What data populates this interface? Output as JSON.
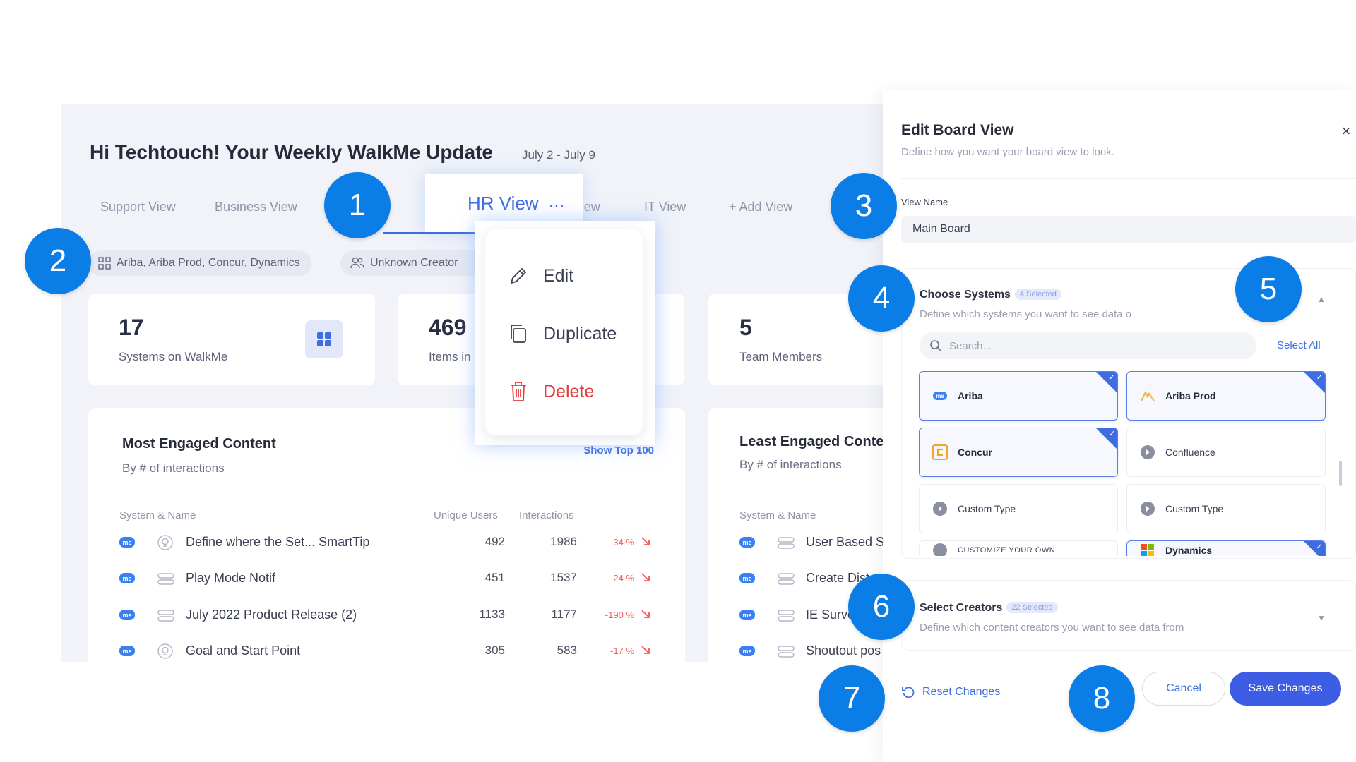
{
  "dashboard": {
    "greeting": "Hi Techtouch! Your Weekly WalkMe Update",
    "date_range": "July 2 - July 9",
    "tabs": {
      "support": "Support View",
      "business": "Business View",
      "hr": "HR View",
      "hr_more": "...",
      "exec": "Exec View",
      "it": "IT View",
      "add": "+ Add View"
    },
    "filters": {
      "systems": "Ariba, Ariba Prod, Concur, Dynamics",
      "creators": "Unknown Creator"
    },
    "cards": [
      {
        "value": "17",
        "label": "Systems on WalkMe"
      },
      {
        "value": "469",
        "label": "Items in"
      },
      {
        "value": "5",
        "label": "Team Members"
      }
    ],
    "most_engaged": {
      "title": "Most Engaged Content",
      "subtitle": "By # of interactions",
      "link": "Show Top 100",
      "columns": {
        "name": "System & Name",
        "users": "Unique Users",
        "interactions": "Interactions"
      },
      "rows": [
        {
          "badge": "me",
          "name": "Define where the Set... SmartTip",
          "icon": "smarttip-icon",
          "users": "492",
          "interactions": "1986",
          "change": "-34 %"
        },
        {
          "badge": "me",
          "name": "Play Mode Notif",
          "icon": "launcher-icon",
          "users": "451",
          "interactions": "1537",
          "change": "-24 %"
        },
        {
          "badge": "me",
          "name": "July 2022 Product Release (2)",
          "icon": "launcher-icon",
          "users": "1133",
          "interactions": "1177",
          "change": "-190 %"
        },
        {
          "badge": "me",
          "name": "Goal and Start Point",
          "icon": "smarttip-icon",
          "users": "305",
          "interactions": "583",
          "change": "-17 %"
        }
      ]
    },
    "least_engaged": {
      "title": "Least Engaged Conte",
      "subtitle": "By # of interactions",
      "columns": {
        "name": "System & Name"
      },
      "rows": [
        {
          "badge": "me",
          "name": "User Based S"
        },
        {
          "badge": "me",
          "name": "Create Dist"
        },
        {
          "badge": "me",
          "name": "IE Surve"
        },
        {
          "badge": "me",
          "name": "Shoutout pos"
        }
      ]
    }
  },
  "context_menu": {
    "edit": "Edit",
    "duplicate": "Duplicate",
    "delete": "Delete"
  },
  "drawer": {
    "title": "Edit Board View",
    "subtitle": "Define how you want your board view to look.",
    "close": "×",
    "view_name_label": "View Name",
    "view_name_value": "Main Board",
    "systems": {
      "title": "Choose Systems",
      "badge": "4 Selected",
      "subtitle": "Define which systems you want to see data o",
      "chevron": "▲",
      "search_placeholder": "Search...",
      "select_all": "Select All",
      "items": [
        {
          "label": "Ariba",
          "selected": true,
          "icon": "ariba-icon"
        },
        {
          "label": "Ariba Prod",
          "selected": true,
          "icon": "ariba-prod-icon"
        },
        {
          "label": "Concur",
          "selected": true,
          "icon": "concur-icon"
        },
        {
          "label": "Confluence",
          "selected": false,
          "icon": "confluence-icon"
        },
        {
          "label": "Custom Type",
          "selected": false,
          "icon": "custom-type-icon"
        },
        {
          "label": "Custom Type",
          "selected": false,
          "icon": "custom-type-icon"
        },
        {
          "label": "CUSTOMIZE YOUR OWN",
          "selected": false,
          "icon": "customize-icon"
        },
        {
          "label": "Dynamics",
          "selected": true,
          "icon": "dynamics-icon"
        }
      ]
    },
    "creators": {
      "title": "Select Creators",
      "badge": "22 Selected",
      "subtitle": "Define which content creators you want to see data from",
      "chevron": "▼"
    },
    "reset": "Reset Changes",
    "cancel": "Cancel",
    "save": "Save Changes"
  },
  "callouts": [
    "1",
    "2",
    "3",
    "4",
    "5",
    "6",
    "7",
    "8"
  ],
  "colors": {
    "accent": "#3d6de0",
    "callout": "#0a7ee6",
    "danger": "#e53b3b",
    "save": "#3d5ee4"
  }
}
